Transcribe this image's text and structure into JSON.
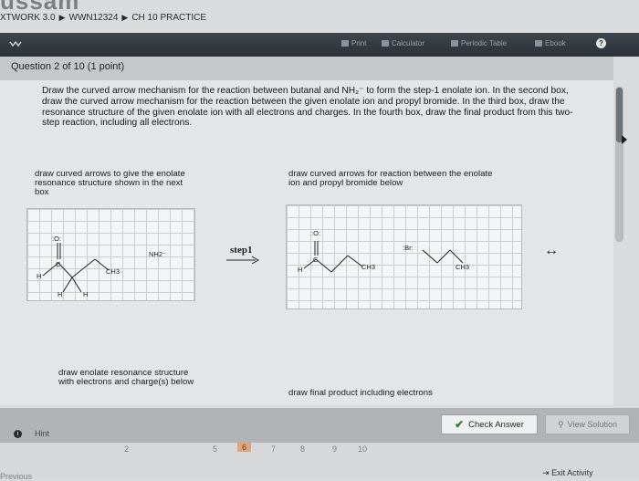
{
  "header": {
    "site_logo_text": "ussam",
    "breadcrumb": [
      "XTWORK 3.0",
      "WWN12324",
      "CH 10 PRACTICE"
    ],
    "breadcrumb_arrow": "▶"
  },
  "toolbar": {
    "menu_icon": "expand-icon",
    "print_label": "Print",
    "calculator_label": "Calculator",
    "periodic_table_label": "Periodic Table",
    "ebook_label": "Ebook",
    "help_glyph": "?"
  },
  "question": {
    "label": "Question 2 of 10 (1 point)",
    "text": "Draw the curved arrow mechanism for the reaction between butanal and NH₂⁻ to form the step-1 enolate ion. In the second box, draw the curved arrow mechanism for the reaction between the given enolate ion and propyl bromide. In the third box, draw the resonance structure of the given enolate ion with all electrons and charges. In the fourth box, draw the final product from this two-step reaction, including all electrons."
  },
  "boxes": {
    "box1_label": "draw curved arrows to give the enolate resonance structure shown in the next box",
    "box2_label": "draw curved arrows for reaction between the enolate ion and propyl bromide below",
    "box3_label": "draw enolate resonance structure with electrons and charge(s) below",
    "box4_label": "draw final product including electrons"
  },
  "chemistry": {
    "box1": {
      "oxygen": ":O:",
      "c": "C",
      "h_left": "H",
      "ch3": "CH3",
      "h1": "H",
      "h2": "H",
      "reagent": "NH2⁻"
    },
    "step_label": "step1",
    "box2": {
      "oxygen": ":O:",
      "c": "C",
      "h_left": "H",
      "ch3_a": "CH3",
      "br": ":Br:",
      "ch3_b": "CH3"
    },
    "resonance_arrow": "↔"
  },
  "footer": {
    "hint_label": "Hint",
    "check_answer_label": "Check Answer",
    "view_solution_label": "View Solution",
    "pages": [
      "2",
      "5",
      "6",
      "7",
      "8",
      "9",
      "10"
    ],
    "active_page": "6",
    "exit_label": "Exit Activity",
    "back_label": "Previous"
  },
  "colors": {
    "toolbar": "#2c3237",
    "check_icon": "#2e7d32",
    "active_page": "#e0a67b"
  }
}
